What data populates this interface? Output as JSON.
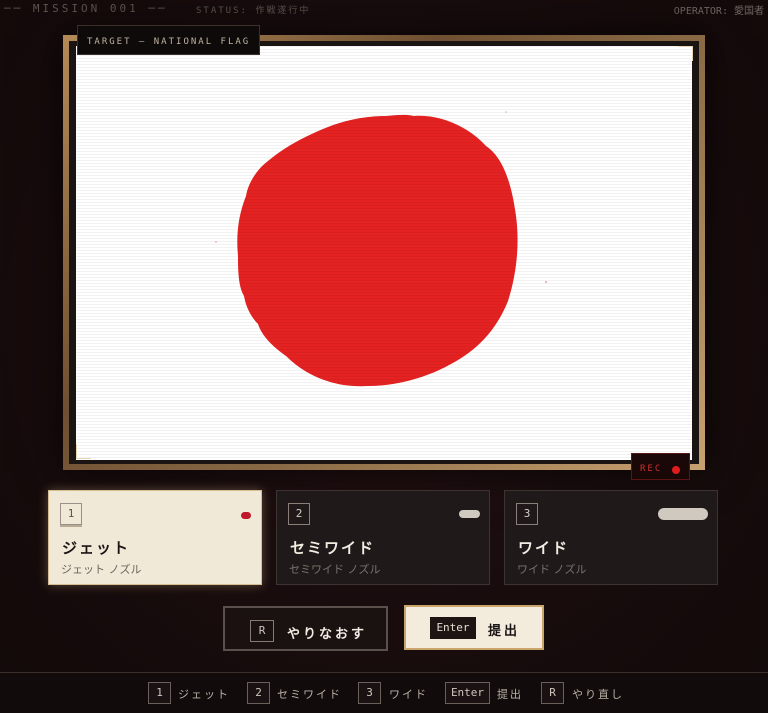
{
  "topbar": {
    "mission": "── MISSION 001 ──",
    "status": "STATUS: 作戦遂行中",
    "operator": "OPERATOR: 愛国者"
  },
  "canvas": {
    "target_label": "TARGET — NATIONAL FLAG",
    "rec_label": "REC",
    "flag_background": "#ffffff",
    "disc_color": "#e52222"
  },
  "nozzles": [
    {
      "key": "1",
      "name": "ジェット",
      "sub": "ジェット ノズル",
      "icon": "jet-nozzle-icon",
      "selected": true
    },
    {
      "key": "2",
      "name": "セミワイド",
      "sub": "セミワイド ノズル",
      "icon": "semiwide-nozzle-icon",
      "selected": false
    },
    {
      "key": "3",
      "name": "ワイド",
      "sub": "ワイド ノズル",
      "icon": "wide-nozzle-icon",
      "selected": false
    }
  ],
  "actions": {
    "reset_key": "R",
    "reset_label": "やりなおす",
    "submit_key": "Enter",
    "submit_label": "提出"
  },
  "hints": [
    {
      "key": "1",
      "label": "ジェット"
    },
    {
      "key": "2",
      "label": "セミワイド"
    },
    {
      "key": "3",
      "label": "ワイド"
    },
    {
      "key": "Enter",
      "label": "提出"
    },
    {
      "key": "R",
      "label": "やり直し"
    }
  ],
  "colors": {
    "accent_gold": "#c9a46b",
    "rec_red": "#e01c1c",
    "selected_card_bg": "#f1e9d8"
  }
}
